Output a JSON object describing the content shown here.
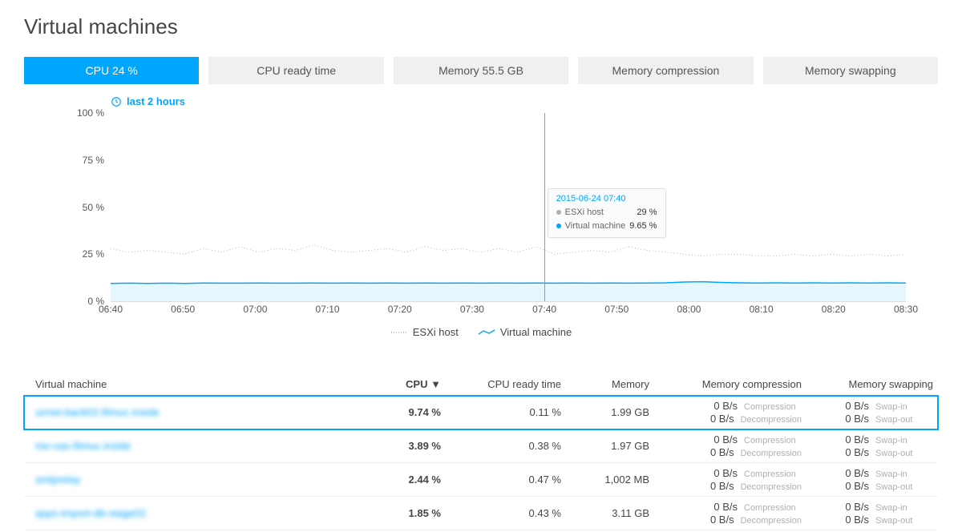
{
  "page_title": "Virtual machines",
  "tabs": [
    {
      "label": "CPU 24 %",
      "active": true
    },
    {
      "label": "CPU ready time",
      "active": false
    },
    {
      "label": "Memory 55.5 GB",
      "active": false
    },
    {
      "label": "Memory compression",
      "active": false
    },
    {
      "label": "Memory swapping",
      "active": false
    }
  ],
  "timerange": "last 2 hours",
  "chart_data": {
    "type": "line",
    "x_ticks": [
      "06:40",
      "06:50",
      "07:00",
      "07:10",
      "07:20",
      "07:30",
      "07:40",
      "07:50",
      "08:00",
      "08:10",
      "08:20",
      "08:30"
    ],
    "ylabel": "%",
    "ylim": [
      0,
      100
    ],
    "y_ticks": [
      0,
      25,
      50,
      75,
      100
    ],
    "series": [
      {
        "name": "ESXi host",
        "style": "dotted",
        "color": "#b0b0b0",
        "values": [
          28,
          26,
          27,
          26,
          25,
          28,
          26,
          29,
          26,
          28,
          27,
          30,
          27,
          26,
          27,
          28,
          26,
          29,
          27,
          28,
          26,
          28,
          26,
          29,
          25,
          26,
          27,
          26,
          29,
          27,
          26,
          25,
          24,
          25,
          25,
          24,
          24,
          25,
          24,
          25,
          24,
          25,
          24,
          25
        ]
      },
      {
        "name": "Virtual machine",
        "style": "solid",
        "color": "#00a6fb",
        "values": [
          9.5,
          9.6,
          9.5,
          9.6,
          9.5,
          9.7,
          9.6,
          9.6,
          9.7,
          9.6,
          9.6,
          9.7,
          9.6,
          9.7,
          9.6,
          9.7,
          9.6,
          9.7,
          9.6,
          9.7,
          9.6,
          9.7,
          9.6,
          9.65,
          9.6,
          9.7,
          9.6,
          9.7,
          9.6,
          9.7,
          9.8,
          10.2,
          10.4,
          10.0,
          9.8,
          9.7,
          9.8,
          9.7,
          9.8,
          9.7,
          9.8,
          9.7,
          9.8,
          9.7
        ]
      }
    ],
    "tooltip": {
      "time": "2015-06-24 07:40",
      "rows": [
        {
          "label": "ESXi host",
          "value": "29 %",
          "color": "#b0b0b0"
        },
        {
          "label": "Virtual machine",
          "value": "9.65 %",
          "color": "#00a6fb"
        }
      ],
      "x_frac": 0.545
    }
  },
  "legend": [
    {
      "label": "ESXi host",
      "style": "dotted"
    },
    {
      "label": "Virtual machine",
      "style": "solid"
    }
  ],
  "table": {
    "columns": [
      "Virtual machine",
      "CPU",
      "CPU ready time",
      "Memory",
      "Memory compression",
      "Memory swapping"
    ],
    "sort_col": "CPU",
    "rows": [
      {
        "vm": "urmel-back02.l9muc.inside",
        "cpu": "9.74 %",
        "ready": "0.11 %",
        "mem": "1.99 GB",
        "comp_a": "0 B/s",
        "comp_b": "0 B/s",
        "swap_a": "0 B/s",
        "swap_b": "0 B/s",
        "selected": true
      },
      {
        "vm": "me-nas.l9muc.inside",
        "cpu": "3.89 %",
        "ready": "0.38 %",
        "mem": "1.97 GB",
        "comp_a": "0 B/s",
        "comp_b": "0 B/s",
        "swap_a": "0 B/s",
        "swap_b": "0 B/s",
        "selected": false
      },
      {
        "vm": "smtprelay",
        "cpu": "2.44 %",
        "ready": "0.47 %",
        "mem": "1,002 MB",
        "comp_a": "0 B/s",
        "comp_b": "0 B/s",
        "swap_a": "0 B/s",
        "swap_b": "0 B/s",
        "selected": false
      },
      {
        "vm": "apps-import-db-stage02",
        "cpu": "1.85 %",
        "ready": "0.43 %",
        "mem": "3.11 GB",
        "comp_a": "0 B/s",
        "comp_b": "0 B/s",
        "swap_a": "0 B/s",
        "swap_b": "0 B/s",
        "selected": false
      }
    ],
    "sub_labels": {
      "comp_a": "Compression",
      "comp_b": "Decompression",
      "swap_a": "Swap-in",
      "swap_b": "Swap-out"
    }
  }
}
